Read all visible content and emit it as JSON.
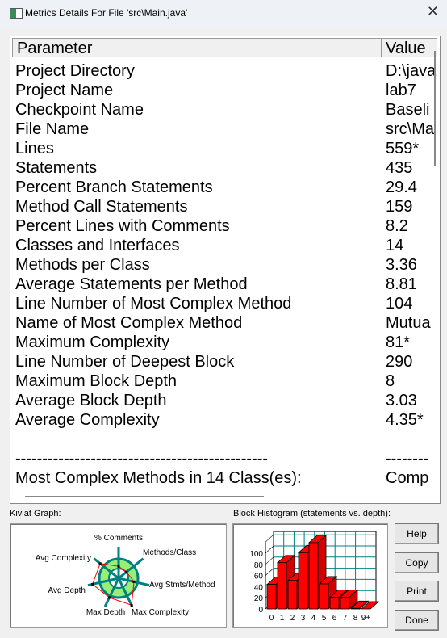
{
  "window": {
    "title": "Metrics Details For File 'src\\Main.java'",
    "close_icon": "close-icon"
  },
  "table": {
    "headers": [
      "Parameter",
      "Value"
    ],
    "rows": [
      [
        "Project Directory",
        "D:\\java"
      ],
      [
        "Project Name",
        "lab7"
      ],
      [
        "Checkpoint Name",
        "Baseli"
      ],
      [
        "File Name",
        "src\\Ma"
      ],
      [
        "Lines",
        "559*"
      ],
      [
        "Statements",
        "435"
      ],
      [
        "Percent Branch Statements",
        "29.4"
      ],
      [
        "Method Call Statements",
        "159"
      ],
      [
        "Percent Lines with Comments",
        "8.2"
      ],
      [
        "Classes and Interfaces",
        "14"
      ],
      [
        "Methods per Class",
        "3.36"
      ],
      [
        "Average Statements per Method",
        "8.81"
      ],
      [
        "Line Number of Most Complex Method",
        "104"
      ],
      [
        "Name of Most Complex Method",
        "Mutua"
      ],
      [
        "Maximum Complexity",
        "81*"
      ],
      [
        "Line Number of Deepest Block",
        "290"
      ],
      [
        "Maximum Block Depth",
        "8"
      ],
      [
        "Average Block Depth",
        "3.03"
      ],
      [
        "Average Complexity",
        "4.35*"
      ],
      [
        "",
        ""
      ],
      [
        "-----------------------------------------------",
        "--------"
      ],
      [
        "Most Complex Methods in 14 Class(es):",
        "Comp"
      ]
    ]
  },
  "kiviat": {
    "label": "Kiviat Graph:",
    "axes": [
      "% Comments",
      "Methods/Class",
      "Avg Stmts/Method",
      "Max Complexity",
      "Max Depth",
      "Avg Depth",
      "Avg Complexity"
    ],
    "levels": [
      0.38,
      0.32,
      0.5,
      0.95,
      0.68,
      0.85,
      0.75
    ],
    "colors": {
      "ring": "#99ee77",
      "spoke": "#008080",
      "line": "#ff0000"
    }
  },
  "histogram": {
    "label": "Block Histogram (statements vs. depth):"
  },
  "chart_data": {
    "type": "bar",
    "title": "Block Histogram (statements vs. depth):",
    "categories": [
      "0",
      "1",
      "2",
      "3",
      "4",
      "5",
      "6",
      "7",
      "8",
      "9+"
    ],
    "values": [
      44,
      83,
      51,
      101,
      119,
      45,
      21,
      21,
      1,
      0
    ],
    "yticks": [
      0,
      20,
      40,
      60,
      80,
      100
    ],
    "ylim": [
      0,
      120
    ],
    "grid": true,
    "bar_color": "#ff0000",
    "grid_color": "#008080"
  },
  "buttons": {
    "help": "Help",
    "copy": "Copy",
    "print": "Print",
    "done": "Done"
  }
}
